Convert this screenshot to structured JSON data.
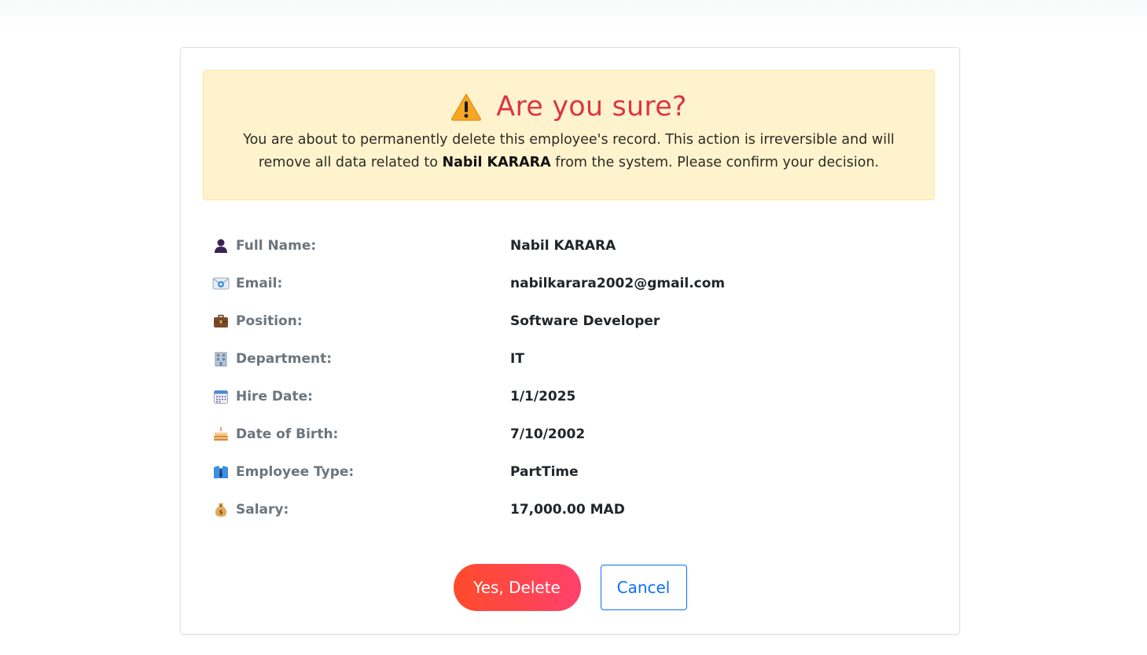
{
  "alert": {
    "icon": "warning-icon",
    "heading": "Are you sure?",
    "text_before": "You are about to permanently delete this employee's record. This action is irreversible and will remove all data related to ",
    "employee_name": "Nabil KARARA",
    "text_after": " from the system. Please confirm your decision.",
    "heading_color": "#dc3545",
    "background_color": "#fff3cd"
  },
  "details": [
    {
      "icon": "person-icon",
      "label": "Full Name:",
      "value": "Nabil KARARA"
    },
    {
      "icon": "email-icon",
      "label": "Email:",
      "value": "nabilkarara2002@gmail.com"
    },
    {
      "icon": "briefcase-icon",
      "label": "Position:",
      "value": "Software Developer"
    },
    {
      "icon": "office-building-icon",
      "label": "Department:",
      "value": "IT"
    },
    {
      "icon": "calendar-icon",
      "label": "Hire Date:",
      "value": "1/1/2025"
    },
    {
      "icon": "birthday-cake-icon",
      "label": "Date of Birth:",
      "value": "7/10/2002"
    },
    {
      "icon": "necktie-icon",
      "label": "Employee Type:",
      "value": "PartTime"
    },
    {
      "icon": "money-bag-icon",
      "label": "Salary:",
      "value": "17,000.00 MAD"
    }
  ],
  "actions": {
    "confirm_label": "Yes, Delete",
    "cancel_label": "Cancel",
    "confirm_gradient": [
      "#ff4b2b",
      "#ff416c"
    ],
    "cancel_color": "#0d6efd"
  }
}
